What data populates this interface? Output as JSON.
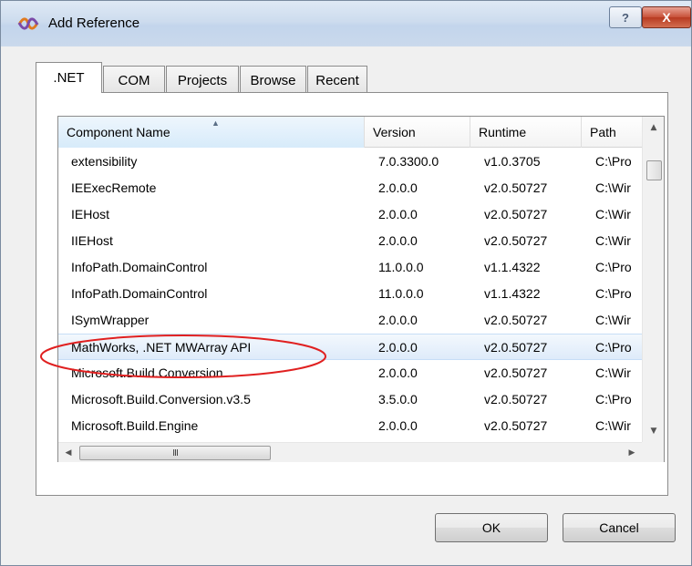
{
  "window": {
    "title": "Add Reference",
    "help_label": "?",
    "close_label": "X"
  },
  "tabs": [
    {
      "label": ".NET",
      "active": true
    },
    {
      "label": "COM"
    },
    {
      "label": "Projects"
    },
    {
      "label": "Browse"
    },
    {
      "label": "Recent"
    }
  ],
  "list": {
    "columns": [
      "Component Name",
      "Version",
      "Runtime",
      "Path"
    ],
    "sorted_column": "Component Name",
    "rows": [
      {
        "name": "extensibility",
        "version": "7.0.3300.0",
        "runtime": "v1.0.3705",
        "path": "C:\\Pro"
      },
      {
        "name": "IEExecRemote",
        "version": "2.0.0.0",
        "runtime": "v2.0.50727",
        "path": "C:\\Wir"
      },
      {
        "name": "IEHost",
        "version": "2.0.0.0",
        "runtime": "v2.0.50727",
        "path": "C:\\Wir"
      },
      {
        "name": "IIEHost",
        "version": "2.0.0.0",
        "runtime": "v2.0.50727",
        "path": "C:\\Wir"
      },
      {
        "name": "InfoPath.DomainControl",
        "version": "11.0.0.0",
        "runtime": "v1.1.4322",
        "path": "C:\\Pro"
      },
      {
        "name": "InfoPath.DomainControl",
        "version": "11.0.0.0",
        "runtime": "v1.1.4322",
        "path": "C:\\Pro"
      },
      {
        "name": "ISymWrapper",
        "version": "2.0.0.0",
        "runtime": "v2.0.50727",
        "path": "C:\\Wir"
      },
      {
        "name": "MathWorks, .NET MWArray API",
        "version": "2.0.0.0",
        "runtime": "v2.0.50727",
        "path": "C:\\Pro",
        "selected": true
      },
      {
        "name": "Microsoft.Build.Conversion",
        "version": "2.0.0.0",
        "runtime": "v2.0.50727",
        "path": "C:\\Wir"
      },
      {
        "name": "Microsoft.Build.Conversion.v3.5",
        "version": "3.5.0.0",
        "runtime": "v2.0.50727",
        "path": "C:\\Pro"
      },
      {
        "name": "Microsoft.Build.Engine",
        "version": "2.0.0.0",
        "runtime": "v2.0.50727",
        "path": "C:\\Wir"
      }
    ]
  },
  "scrollbar": {
    "thumb_glyph": "III"
  },
  "buttons": {
    "ok": "OK",
    "cancel": "Cancel"
  },
  "colors": {
    "annotation": "#e02020",
    "selection": "#deebfa",
    "close_button": "#c75038"
  },
  "icons": {
    "title": "visual-studio-icon"
  }
}
